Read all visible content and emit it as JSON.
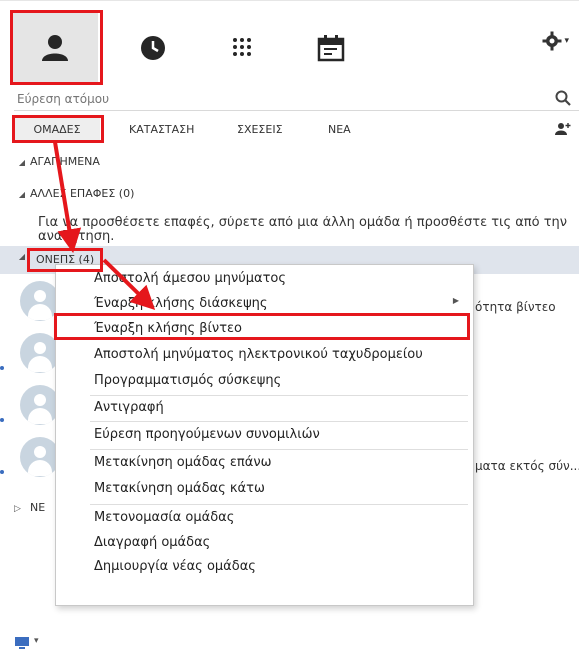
{
  "toolbar": {
    "tabs": [
      {
        "icon": "contacts-icon",
        "active": true
      },
      {
        "icon": "clock-icon"
      },
      {
        "icon": "dialpad-icon"
      },
      {
        "icon": "calendar-icon"
      }
    ],
    "settings_icon": "gear-icon"
  },
  "search": {
    "placeholder": "Εύρεση ατόμου"
  },
  "filters": [
    "ΟΜΑΔΕΣ",
    "ΚΑΤΑΣΤΑΣΗ",
    "ΣΧΕΣΕΙΣ",
    "ΝΕΑ"
  ],
  "groups": {
    "favorites": "ΑΓΑΠΗΜΕΝΑ",
    "other_contacts": "ΑΛΛΕΣ ΕΠΑΦΕΣ (0)",
    "hint": "Για να προσθέσετε επαφές, σύρετε από μια άλλη ομάδα ή προσθέστε τις από την",
    "hint_line2": "αναζήτηση.",
    "group_name": "ΟΝΕΠΣ (4)",
    "collapsed_group": "ΝΕ"
  },
  "contact_side": {
    "video_status": "ότητα βίντεο",
    "messages_status": "ματα εκτός σύν..."
  },
  "context_menu": {
    "items": [
      {
        "label": "Αποστολή άμεσου μηνύματος"
      },
      {
        "label": "Έναρξη κλήσης διάσκεψης",
        "submenu": true
      },
      {
        "label": "Έναρξη κλήσης βίντεο"
      },
      {
        "label": "Αποστολή μηνύματος ηλεκτρονικού ταχυδρομείου"
      },
      {
        "label": "Προγραμματισμός σύσκεψης"
      },
      {
        "label": "Αντιγραφή"
      },
      {
        "label": "Εύρεση προηγούμενων συνομιλιών"
      },
      {
        "label": "Μετακίνηση ομάδας επάνω"
      },
      {
        "label": "Μετακίνηση ομάδας κάτω"
      },
      {
        "label": "Μετονομασία ομάδας"
      },
      {
        "label": "Διαγραφή ομάδας"
      },
      {
        "label": "Δημιουργία νέας ομάδας"
      }
    ]
  },
  "colors": {
    "highlight": "#e5171c",
    "arrow": "#e5171c",
    "group_bar": "#dfe4ec",
    "active_tab": "#e5e5e5"
  }
}
